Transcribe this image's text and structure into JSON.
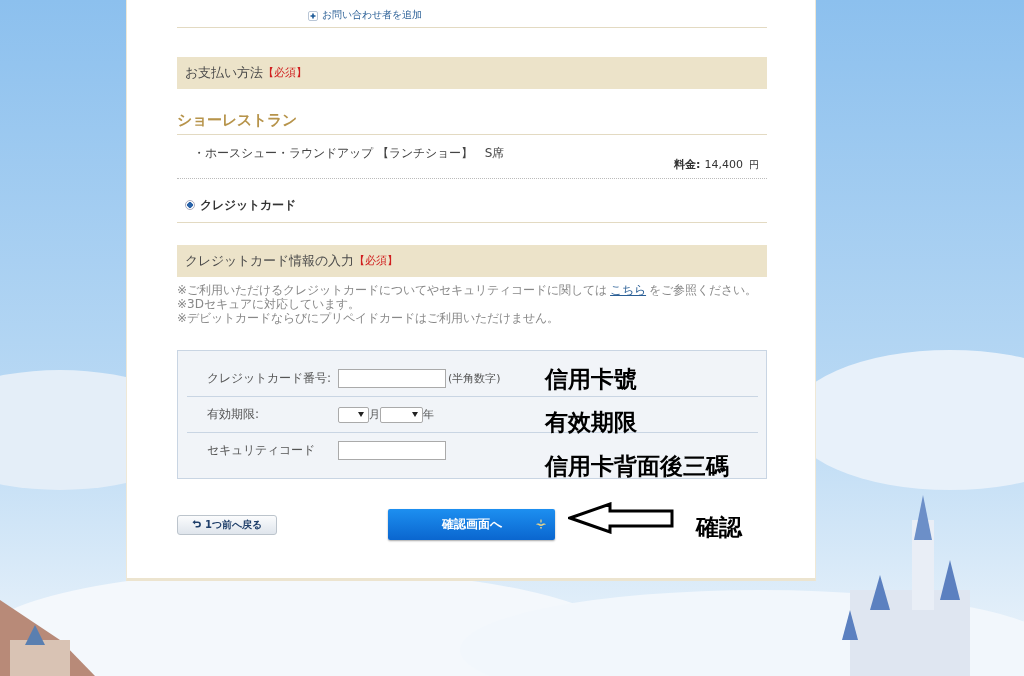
{
  "contact_link": "お問い合わせ者を追加",
  "payment_section": {
    "title": "お支払い方法",
    "required": "【必須】"
  },
  "restaurant": {
    "title": "ショーレストラン",
    "item": "・ホースシュー・ラウンドアップ 【ランチショー】　S席",
    "price_label": "料金:",
    "price": "14,400",
    "currency": "円"
  },
  "payment_methods": [
    {
      "label": "クレジットカード",
      "selected": true
    }
  ],
  "card_section": {
    "title": "クレジットカード情報の入力",
    "required": "【必須】"
  },
  "notes": [
    {
      "before": "※ご利用いただけるクレジットカードについてやセキュリティコードに関しては",
      "link": "こちら",
      "after": "をご参照ください。"
    },
    {
      "before": "※3Dセキュアに対応しています。"
    },
    {
      "before": "※デビットカードならびにプリペイドカードはご利用いただけません。"
    }
  ],
  "form_rows": [
    {
      "kind": "text",
      "label": "クレジットカード番号:",
      "hint": "(半角数字)"
    },
    {
      "kind": "expiry",
      "label": "有効期限:",
      "month_unit": "月",
      "year_unit": "年"
    },
    {
      "kind": "text",
      "label": "セキュリティコード"
    }
  ],
  "buttons": {
    "back": "1つ前へ戻る",
    "next": "確認画面へ"
  },
  "annotations": [
    {
      "text": "信用卡號"
    },
    {
      "text": "有效期限"
    },
    {
      "text": "信用卡背面後三碼"
    },
    {
      "text": "確認"
    }
  ]
}
